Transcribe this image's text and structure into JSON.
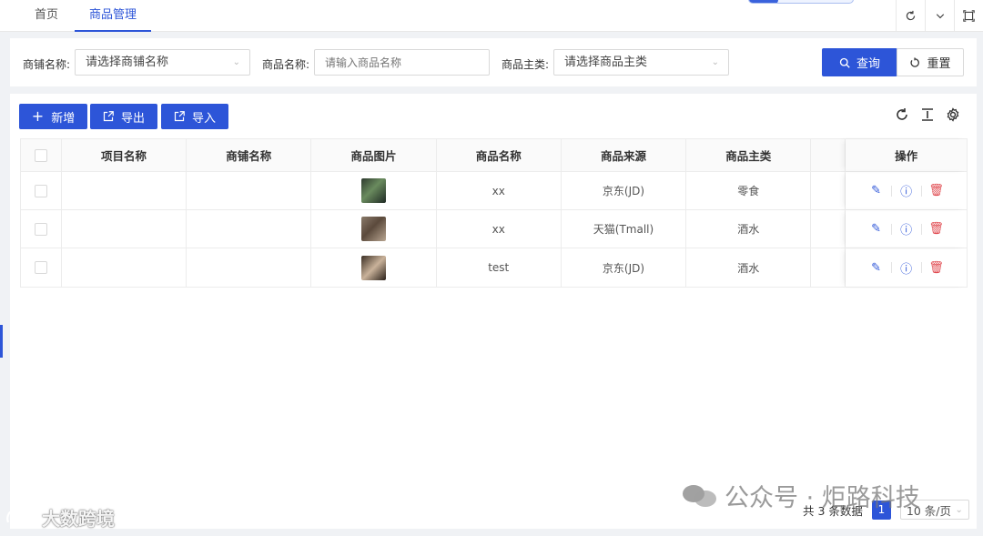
{
  "tabs": [
    {
      "label": "首页"
    },
    {
      "label": "商品管理"
    }
  ],
  "top_icons": [
    "refresh-icon",
    "chevron-down-icon",
    "fullscreen-icon"
  ],
  "search": {
    "shop_label": "商铺名称:",
    "shop_placeholder": "请选择商铺名称",
    "product_label": "商品名称:",
    "product_placeholder": "请输入商品名称",
    "category_label": "商品主类:",
    "category_placeholder": "请选择商品主类",
    "query_label": "查询",
    "reset_label": "重置"
  },
  "toolbar": {
    "add_label": "新增",
    "export_label": "导出",
    "import_label": "导入"
  },
  "table": {
    "headers": [
      "项目名称",
      "商铺名称",
      "商品图片",
      "商品名称",
      "商品来源",
      "商品主类",
      "",
      "操作"
    ],
    "rows": [
      {
        "project": "",
        "shop": "",
        "name": "xx",
        "source": "京东(JD)",
        "category": "零食"
      },
      {
        "project": "",
        "shop": "",
        "name": "xx",
        "source": "天猫(Tmall)",
        "category": "酒水"
      },
      {
        "project": "",
        "shop": "",
        "name": "test",
        "source": "京东(JD)",
        "category": "酒水"
      }
    ]
  },
  "pagination": {
    "total_text": "共 3 条数据",
    "current_page": "1",
    "page_size": "10 条/页"
  },
  "watermarks": {
    "left": "大数跨境",
    "right": "公众号 · 炬路科技"
  },
  "colors": {
    "primary": "#2d55d8",
    "danger": "#e0494f"
  }
}
